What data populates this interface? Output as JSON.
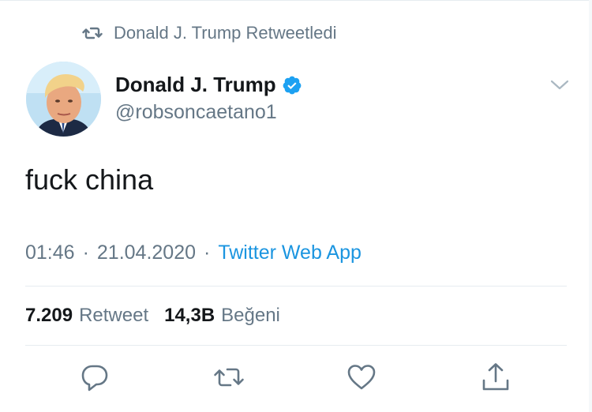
{
  "retweet_context": {
    "text": "Donald J. Trump Retweetledi",
    "icon": "retweet-icon"
  },
  "author": {
    "display_name": "Donald J. Trump",
    "handle": "@robsoncaetano1",
    "verified": true,
    "avatar_icon": "avatar"
  },
  "tweet": {
    "text": "fuck china"
  },
  "meta": {
    "time": "01:46",
    "separator": "·",
    "date": "21.04.2020",
    "source": "Twitter Web App"
  },
  "stats": {
    "retweets_count": "7.209",
    "retweets_label": "Retweet",
    "likes_count": "14,3B",
    "likes_label": "Beğeni"
  },
  "actions": [
    "reply-icon",
    "retweet-icon",
    "like-icon",
    "share-icon"
  ],
  "colors": {
    "text_primary": "#14171a",
    "text_secondary": "#657786",
    "link": "#1b95e0",
    "verified": "#1da1f2",
    "divider": "#e6ecf0"
  }
}
